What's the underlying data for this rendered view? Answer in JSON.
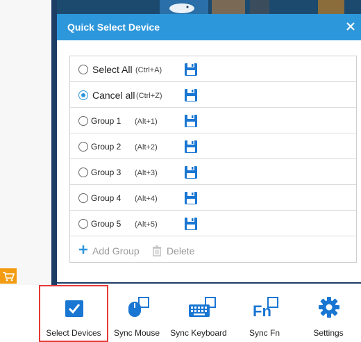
{
  "dialog": {
    "title": "Quick Select Device",
    "close_icon": "close-icon"
  },
  "options": [
    {
      "label": "Select All",
      "shortcut": "(Ctrl+A)",
      "checked": false
    },
    {
      "label": "Cancel all",
      "shortcut": "(Ctrl+Z)",
      "checked": true
    },
    {
      "label": "Group 1",
      "shortcut": "(Alt+1)",
      "checked": false
    },
    {
      "label": "Group 2",
      "shortcut": "(Alt+2)",
      "checked": false
    },
    {
      "label": "Group 3",
      "shortcut": "(Alt+3)",
      "checked": false
    },
    {
      "label": "Group 4",
      "shortcut": "(Alt+4)",
      "checked": false
    },
    {
      "label": "Group 5",
      "shortcut": "(Alt+5)",
      "checked": false
    }
  ],
  "actions": {
    "add_group": "Add Group",
    "delete": "Delete"
  },
  "toolbar": {
    "items": [
      {
        "label": "Select Devices",
        "icon": "checkbox-icon",
        "selected": true
      },
      {
        "label": "Sync Mouse",
        "icon": "mouse-icon",
        "selected": false
      },
      {
        "label": "Sync Keyboard",
        "icon": "keyboard-icon",
        "selected": false
      },
      {
        "label": "Sync Fn",
        "icon": "fn-icon",
        "selected": false
      },
      {
        "label": "Settings",
        "icon": "gear-icon",
        "selected": false
      }
    ]
  },
  "colors": {
    "accent": "#2d97db",
    "selected_border": "#e53935",
    "cart_badge": "#f39c12"
  }
}
